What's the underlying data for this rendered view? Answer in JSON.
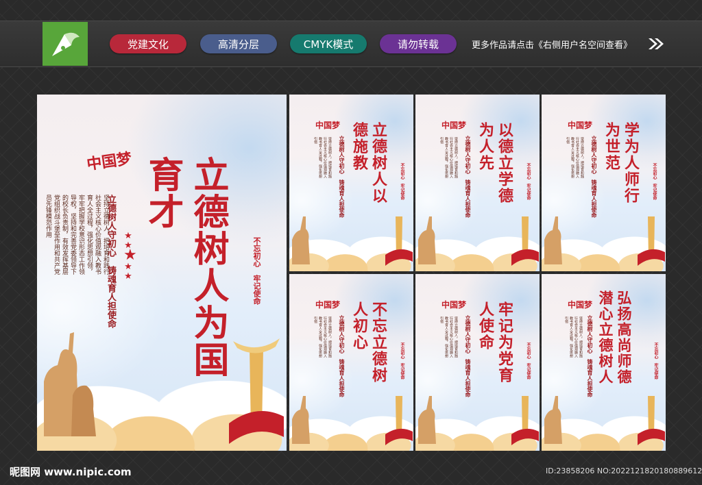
{
  "header": {
    "tags": [
      "党建文化",
      "高清分层",
      "CMYK模式",
      "请勿转载"
    ],
    "notice": "更多作品请点击《右侧用户名空间查看》",
    "arrow_icon": "double-chevron-right-icon",
    "logo_icon": "pen-nib-logo-icon"
  },
  "main_poster": {
    "emblem": "中国梦",
    "title": "立德树人为国育才",
    "subtitle": "立德树人守初心　铸魂育人担使命",
    "body": "坚持立德树人，把培育和践行社会主义核心价值观融入教书育人全过程，强化思想引领，牢牢把握学校意识形态工作领导权，坚持和完善党委领导下的校长负责制，有效发挥基层党组织战斗堡垒作用和共产党员先锋模范作用",
    "motto": "不忘初心　牢记使命"
  },
  "small_posters": [
    {
      "title": "立德树人以德施教",
      "subtitle": "立德树人守初心　铸魂育人担使命",
      "motto": "不忘初心　牢记使命"
    },
    {
      "title": "以德立学德为人先",
      "subtitle": "立德树人守初心　铸魂育人担使命",
      "motto": "不忘初心　牢记使命"
    },
    {
      "title": "学为人师行为世范",
      "subtitle": "立德树人守初心　铸魂育人担使命",
      "motto": "不忘初心　牢记使命"
    },
    {
      "title": "不忘立德树人初心",
      "subtitle": "立德树人守初心　铸魂育人担使命",
      "motto": "不忘初心　牢记使命"
    },
    {
      "title": "牢记为党育人使命",
      "subtitle": "立德树人守初心　铸魂育人担使命",
      "motto": "不忘初心　牢记使命"
    },
    {
      "title": "弘扬高尚师德潜心立德树人",
      "subtitle": "立德树人守初心　铸魂育人担使命",
      "motto": "不忘初心　牢记使命"
    }
  ],
  "small_body": "坚持立德树人，把培育和践行社会主义核心价值观融入教书育人全过程，强化思想引领",
  "footer": {
    "site": "昵图网 www.nipic.com",
    "id": "ID:23858206 NO:20221218201808896122"
  },
  "colors": {
    "accent": "#c4202a",
    "gold": "#e8b55a"
  }
}
